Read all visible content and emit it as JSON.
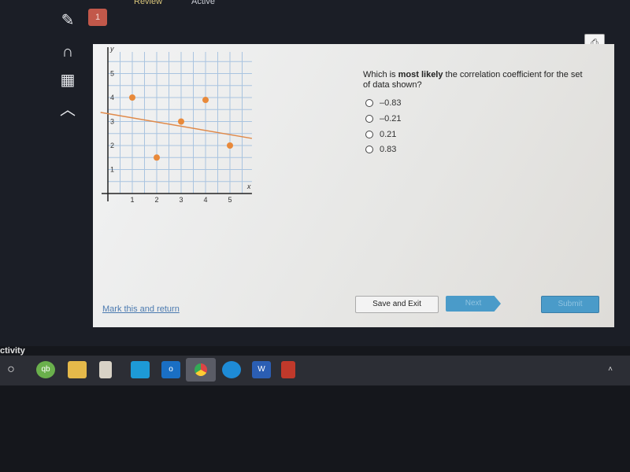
{
  "top": {
    "title_fragment": "Review",
    "status": "Active",
    "question_number": "1"
  },
  "tools": [
    "pencil-icon",
    "headphones-icon",
    "calculator-icon",
    "collapse-icon"
  ],
  "question": {
    "pre": "Which is ",
    "bold": "most likely",
    "post": " the correlation coefficient for the set of data shown?"
  },
  "options": [
    "–0.83",
    "–0.21",
    "0.21",
    "0.83"
  ],
  "footer": {
    "mark": "Mark this and return",
    "save": "Save and Exit",
    "next": "Next",
    "submit": "Submit"
  },
  "taskbar": {
    "activity_text": "ctivity",
    "apps": [
      "cortana",
      "quickbooks",
      "file-explorer",
      "onedrive",
      "app",
      "outlook",
      "chrome",
      "edge",
      "word",
      "acrobat"
    ]
  },
  "colors": {
    "point": "#e8893a",
    "line": "#e08a4a",
    "grid": "#a9c4e0",
    "button": "#4a9bc9"
  },
  "chart_data": {
    "type": "scatter",
    "xlabel": "x",
    "ylabel": "y",
    "xticks": [
      "1",
      "2",
      "3",
      "4",
      "5"
    ],
    "yticks": [
      "1",
      "2",
      "3",
      "4",
      "5"
    ],
    "xlim": [
      0,
      5.9
    ],
    "ylim": [
      0,
      5.9
    ],
    "grid": true,
    "grid_step": 0.5,
    "points": [
      {
        "x": 1,
        "y": 4
      },
      {
        "x": 2,
        "y": 1.5
      },
      {
        "x": 3,
        "y": 3
      },
      {
        "x": 4,
        "y": 3.9
      },
      {
        "x": 5,
        "y": 2
      }
    ],
    "trend_line": [
      [
        -0.3,
        3.38
      ],
      [
        6,
        2.28
      ]
    ]
  }
}
